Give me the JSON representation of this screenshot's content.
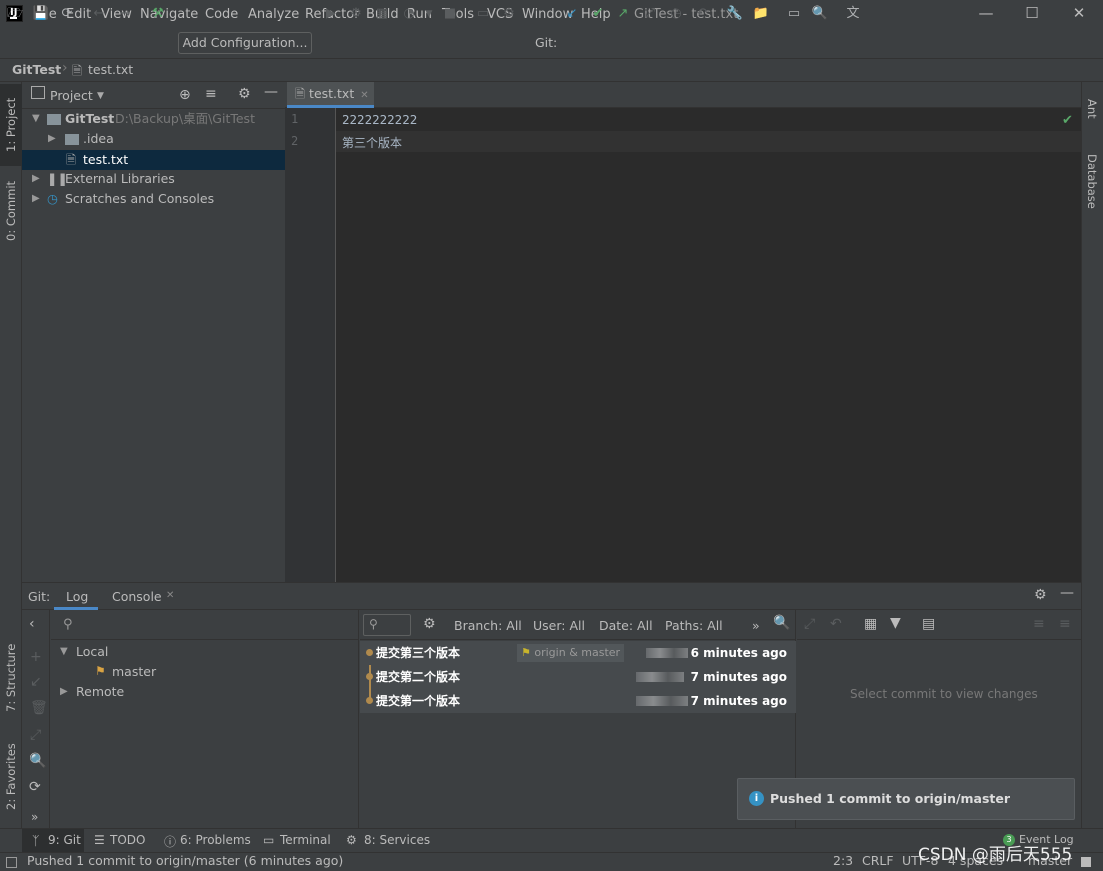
{
  "titlebar": {
    "menu": [
      "File",
      "Edit",
      "View",
      "Navigate",
      "Code",
      "Analyze",
      "Refactor",
      "Build",
      "Run",
      "Tools",
      "VCS",
      "Window",
      "Help"
    ],
    "title": "GitTest - test.txt"
  },
  "toolbar": {
    "add_configuration": "Add Configuration...",
    "git_label": "Git:"
  },
  "navbar": {
    "root": "GitTest",
    "file": "test.txt"
  },
  "left_stripe": {
    "project": "1: Project",
    "commit": "0: Commit",
    "structure": "7: Structure",
    "favorites": "2: Favorites"
  },
  "right_stripe": {
    "ant": "Ant",
    "database": "Database"
  },
  "project_panel": {
    "title": "Project",
    "root_name": "GitTest",
    "root_path": "D:\\Backup\\桌面\\GitTest",
    "idea": ".idea",
    "file": "test.txt",
    "ext_libs": "External Libraries",
    "scratches": "Scratches and Consoles"
  },
  "editor": {
    "tab": "test.txt",
    "lines": [
      {
        "num": "1",
        "text": "2222222222"
      },
      {
        "num": "2",
        "text": "第三个版本"
      }
    ]
  },
  "git_panel": {
    "label": "Git:",
    "tab_log": "Log",
    "tab_console": "Console",
    "local": "Local",
    "master": "master",
    "remote": "Remote",
    "filters": {
      "branch": "Branch: All",
      "user": "User: All",
      "date": "Date: All",
      "paths": "Paths: All"
    },
    "commits": [
      {
        "message": "提交第三个版本",
        "refs": "origin & master",
        "time": "6 minutes ago"
      },
      {
        "message": "提交第二个版本",
        "refs": "",
        "time": "7 minutes ago"
      },
      {
        "message": "提交第一个版本",
        "refs": "",
        "time": "7 minutes ago"
      }
    ],
    "empty_detail": "Select commit to view changes"
  },
  "notification": {
    "text": "Pushed 1 commit to origin/master"
  },
  "bottom_tabs": {
    "git": "9: Git",
    "todo": "TODO",
    "problems": "6: Problems",
    "terminal": "Terminal",
    "services": "8: Services",
    "event_log": "Event Log",
    "event_count": "3"
  },
  "statusbar": {
    "message": "Pushed 1 commit to origin/master (6 minutes ago)",
    "position": "2:3",
    "line_sep": "CRLF",
    "encoding": "UTF-8",
    "indent": "4 spaces",
    "branch": "master",
    "watermark": "CSDN @雨后天555"
  },
  "colors": {
    "accent": "#4a88c7",
    "bg": "#3c3f41",
    "editor_bg": "#2b2b2b",
    "selection": "#0d293e"
  }
}
